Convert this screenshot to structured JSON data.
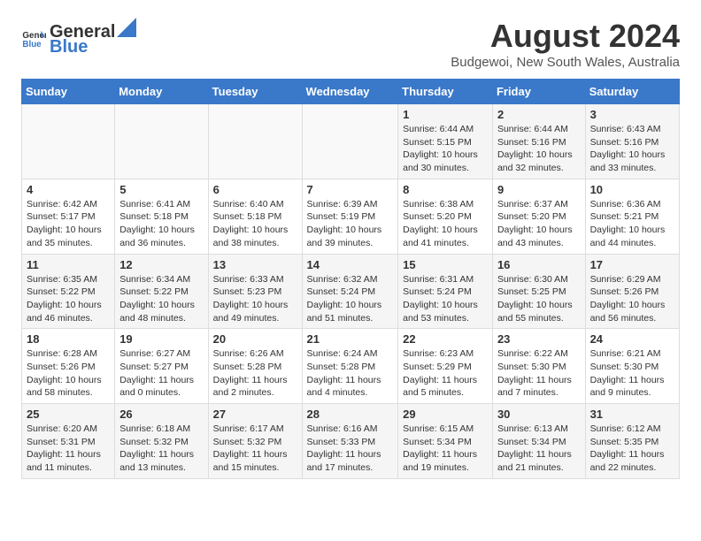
{
  "header": {
    "logo_general": "General",
    "logo_blue": "Blue",
    "main_title": "August 2024",
    "subtitle": "Budgewoi, New South Wales, Australia"
  },
  "weekdays": [
    "Sunday",
    "Monday",
    "Tuesday",
    "Wednesday",
    "Thursday",
    "Friday",
    "Saturday"
  ],
  "weeks": [
    [
      {
        "day": "",
        "info": ""
      },
      {
        "day": "",
        "info": ""
      },
      {
        "day": "",
        "info": ""
      },
      {
        "day": "",
        "info": ""
      },
      {
        "day": "1",
        "info": "Sunrise: 6:44 AM\nSunset: 5:15 PM\nDaylight: 10 hours and 30 minutes."
      },
      {
        "day": "2",
        "info": "Sunrise: 6:44 AM\nSunset: 5:16 PM\nDaylight: 10 hours and 32 minutes."
      },
      {
        "day": "3",
        "info": "Sunrise: 6:43 AM\nSunset: 5:16 PM\nDaylight: 10 hours and 33 minutes."
      }
    ],
    [
      {
        "day": "4",
        "info": "Sunrise: 6:42 AM\nSunset: 5:17 PM\nDaylight: 10 hours and 35 minutes."
      },
      {
        "day": "5",
        "info": "Sunrise: 6:41 AM\nSunset: 5:18 PM\nDaylight: 10 hours and 36 minutes."
      },
      {
        "day": "6",
        "info": "Sunrise: 6:40 AM\nSunset: 5:18 PM\nDaylight: 10 hours and 38 minutes."
      },
      {
        "day": "7",
        "info": "Sunrise: 6:39 AM\nSunset: 5:19 PM\nDaylight: 10 hours and 39 minutes."
      },
      {
        "day": "8",
        "info": "Sunrise: 6:38 AM\nSunset: 5:20 PM\nDaylight: 10 hours and 41 minutes."
      },
      {
        "day": "9",
        "info": "Sunrise: 6:37 AM\nSunset: 5:20 PM\nDaylight: 10 hours and 43 minutes."
      },
      {
        "day": "10",
        "info": "Sunrise: 6:36 AM\nSunset: 5:21 PM\nDaylight: 10 hours and 44 minutes."
      }
    ],
    [
      {
        "day": "11",
        "info": "Sunrise: 6:35 AM\nSunset: 5:22 PM\nDaylight: 10 hours and 46 minutes."
      },
      {
        "day": "12",
        "info": "Sunrise: 6:34 AM\nSunset: 5:22 PM\nDaylight: 10 hours and 48 minutes."
      },
      {
        "day": "13",
        "info": "Sunrise: 6:33 AM\nSunset: 5:23 PM\nDaylight: 10 hours and 49 minutes."
      },
      {
        "day": "14",
        "info": "Sunrise: 6:32 AM\nSunset: 5:24 PM\nDaylight: 10 hours and 51 minutes."
      },
      {
        "day": "15",
        "info": "Sunrise: 6:31 AM\nSunset: 5:24 PM\nDaylight: 10 hours and 53 minutes."
      },
      {
        "day": "16",
        "info": "Sunrise: 6:30 AM\nSunset: 5:25 PM\nDaylight: 10 hours and 55 minutes."
      },
      {
        "day": "17",
        "info": "Sunrise: 6:29 AM\nSunset: 5:26 PM\nDaylight: 10 hours and 56 minutes."
      }
    ],
    [
      {
        "day": "18",
        "info": "Sunrise: 6:28 AM\nSunset: 5:26 PM\nDaylight: 10 hours and 58 minutes."
      },
      {
        "day": "19",
        "info": "Sunrise: 6:27 AM\nSunset: 5:27 PM\nDaylight: 11 hours and 0 minutes."
      },
      {
        "day": "20",
        "info": "Sunrise: 6:26 AM\nSunset: 5:28 PM\nDaylight: 11 hours and 2 minutes."
      },
      {
        "day": "21",
        "info": "Sunrise: 6:24 AM\nSunset: 5:28 PM\nDaylight: 11 hours and 4 minutes."
      },
      {
        "day": "22",
        "info": "Sunrise: 6:23 AM\nSunset: 5:29 PM\nDaylight: 11 hours and 5 minutes."
      },
      {
        "day": "23",
        "info": "Sunrise: 6:22 AM\nSunset: 5:30 PM\nDaylight: 11 hours and 7 minutes."
      },
      {
        "day": "24",
        "info": "Sunrise: 6:21 AM\nSunset: 5:30 PM\nDaylight: 11 hours and 9 minutes."
      }
    ],
    [
      {
        "day": "25",
        "info": "Sunrise: 6:20 AM\nSunset: 5:31 PM\nDaylight: 11 hours and 11 minutes."
      },
      {
        "day": "26",
        "info": "Sunrise: 6:18 AM\nSunset: 5:32 PM\nDaylight: 11 hours and 13 minutes."
      },
      {
        "day": "27",
        "info": "Sunrise: 6:17 AM\nSunset: 5:32 PM\nDaylight: 11 hours and 15 minutes."
      },
      {
        "day": "28",
        "info": "Sunrise: 6:16 AM\nSunset: 5:33 PM\nDaylight: 11 hours and 17 minutes."
      },
      {
        "day": "29",
        "info": "Sunrise: 6:15 AM\nSunset: 5:34 PM\nDaylight: 11 hours and 19 minutes."
      },
      {
        "day": "30",
        "info": "Sunrise: 6:13 AM\nSunset: 5:34 PM\nDaylight: 11 hours and 21 minutes."
      },
      {
        "day": "31",
        "info": "Sunrise: 6:12 AM\nSunset: 5:35 PM\nDaylight: 11 hours and 22 minutes."
      }
    ]
  ]
}
